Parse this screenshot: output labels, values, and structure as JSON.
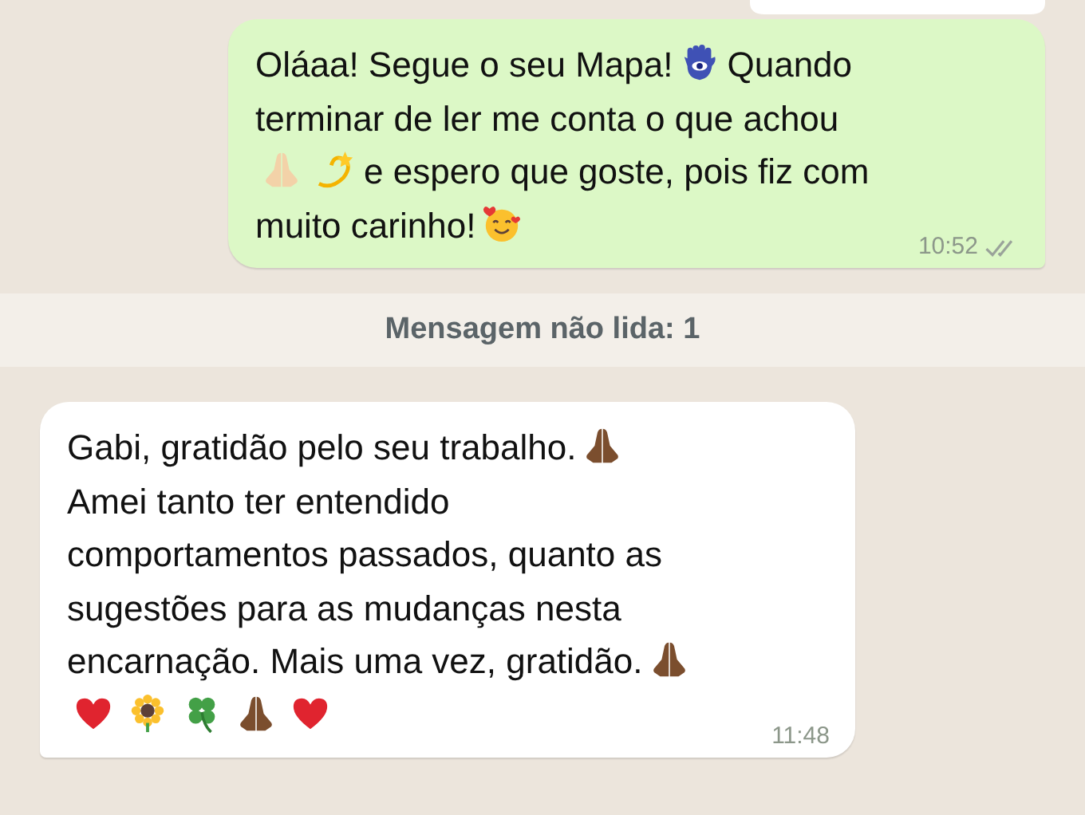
{
  "messages": [
    {
      "kind": "outgoing",
      "time": "10:52",
      "read": false,
      "lines": [
        [
          {
            "kind": "text",
            "text": "Oláaa! Segue o seu Mapa!"
          },
          {
            "kind": "hamsa"
          },
          {
            "kind": "text",
            "text": "Quando"
          }
        ],
        [
          {
            "kind": "text",
            "text": "terminar de ler me conta o que achou"
          }
        ],
        [
          {
            "kind": "pray",
            "color": "#f3d2a8"
          },
          {
            "kind": "dizzy"
          },
          {
            "kind": "text",
            "text": "e espero que goste, pois fiz com"
          }
        ],
        [
          {
            "kind": "text",
            "text": "muito carinho!"
          },
          {
            "kind": "smile"
          }
        ]
      ]
    },
    {
      "kind": "divider",
      "text": "Mensagem não lida: 1"
    },
    {
      "kind": "incoming",
      "time": "11:48",
      "lines": [
        [
          {
            "kind": "text",
            "text": "Gabi, gratidão pelo seu trabalho."
          },
          {
            "kind": "pray",
            "color": "#7b4e2e"
          }
        ],
        [
          {
            "kind": "text",
            "text": "Amei tanto ter entendido"
          }
        ],
        [
          {
            "kind": "text",
            "text": "comportamentos passados, quanto as"
          }
        ],
        [
          {
            "kind": "text",
            "text": "sugestões para as mudanças nesta"
          }
        ],
        [
          {
            "kind": "text",
            "text": "encarnação. Mais uma vez, gratidão."
          },
          {
            "kind": "pray",
            "color": "#7b4e2e"
          }
        ],
        [
          {
            "kind": "heart"
          },
          {
            "kind": "sunflower"
          },
          {
            "kind": "clover"
          },
          {
            "kind": "pray",
            "color": "#7b4e2e"
          },
          {
            "kind": "heart"
          }
        ]
      ]
    }
  ]
}
